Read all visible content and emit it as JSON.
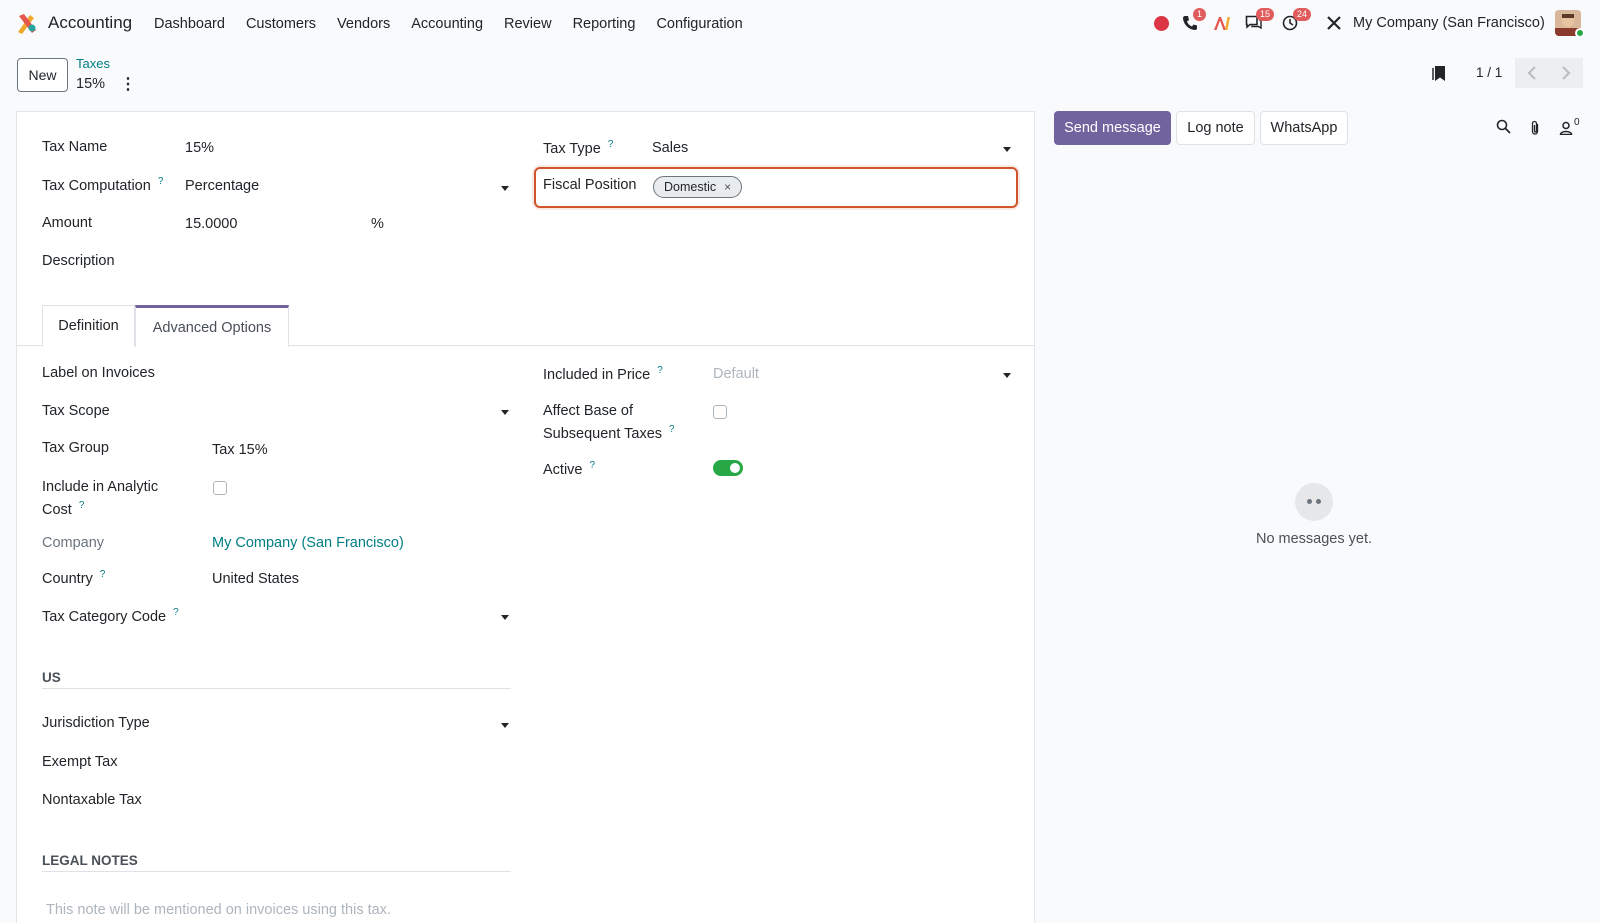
{
  "navbar": {
    "app_name": "Accounting",
    "menu": [
      "Dashboard",
      "Customers",
      "Vendors",
      "Accounting",
      "Review",
      "Reporting",
      "Configuration"
    ],
    "phone_badge": "1",
    "messages_badge": "15",
    "activities_badge": "24",
    "company": "My Company (San Francisco)"
  },
  "control_panel": {
    "new_label": "New",
    "breadcrumb_parent": "Taxes",
    "breadcrumb_current": "15%",
    "gear_glyph": "⋮",
    "pager_value": "1 / 1"
  },
  "form": {
    "tax_name_label": "Tax Name",
    "tax_name_value": "15%",
    "tax_computation_label": "Tax Computation",
    "tax_computation_value": "Percentage",
    "amount_label": "Amount",
    "amount_value": "15.0000",
    "amount_unit": "%",
    "description_label": "Description",
    "tax_type_label": "Tax Type",
    "tax_type_value": "Sales",
    "fiscal_position_label": "Fiscal Position",
    "fiscal_position_tag": "Domestic",
    "tag_remove": "×",
    "help_mark": "?"
  },
  "tabs": {
    "definition": "Definition",
    "advanced_options": "Advanced Options"
  },
  "advanced": {
    "label_on_invoices_label": "Label on Invoices",
    "tax_scope_label": "Tax Scope",
    "tax_group_label": "Tax Group",
    "tax_group_value": "Tax 15%",
    "include_analytic_label_1": "Include in Analytic",
    "include_analytic_label_2": "Cost",
    "company_label": "Company",
    "company_value": "My Company (San Francisco)",
    "country_label": "Country",
    "country_value": "United States",
    "tax_category_code_label": "Tax Category Code",
    "us_section_title": "US",
    "jurisdiction_type_label": "Jurisdiction Type",
    "exempt_tax_label": "Exempt Tax",
    "nontaxable_tax_label": "Nontaxable Tax",
    "legal_notes_title": "LEGAL NOTES",
    "legal_notes_placeholder": "This note will be mentioned on invoices using this tax.",
    "included_in_price_label": "Included in Price",
    "included_in_price_placeholder": "Default",
    "affect_base_label_1": "Affect Base of",
    "affect_base_label_2": "Subsequent Taxes",
    "active_label": "Active",
    "active_on": true,
    "include_analytic_checked": false,
    "affect_base_checked": false
  },
  "chatter": {
    "send_message": "Send message",
    "log_note": "Log note",
    "whatsapp": "WhatsApp",
    "follower_count": "0",
    "empty_text": "No messages yet."
  },
  "colors": {
    "brand": "#71639e",
    "link": "#017e84",
    "focus_border": "#d0542c",
    "toggle_on": "#28a745",
    "badge": "#e05b5b"
  }
}
